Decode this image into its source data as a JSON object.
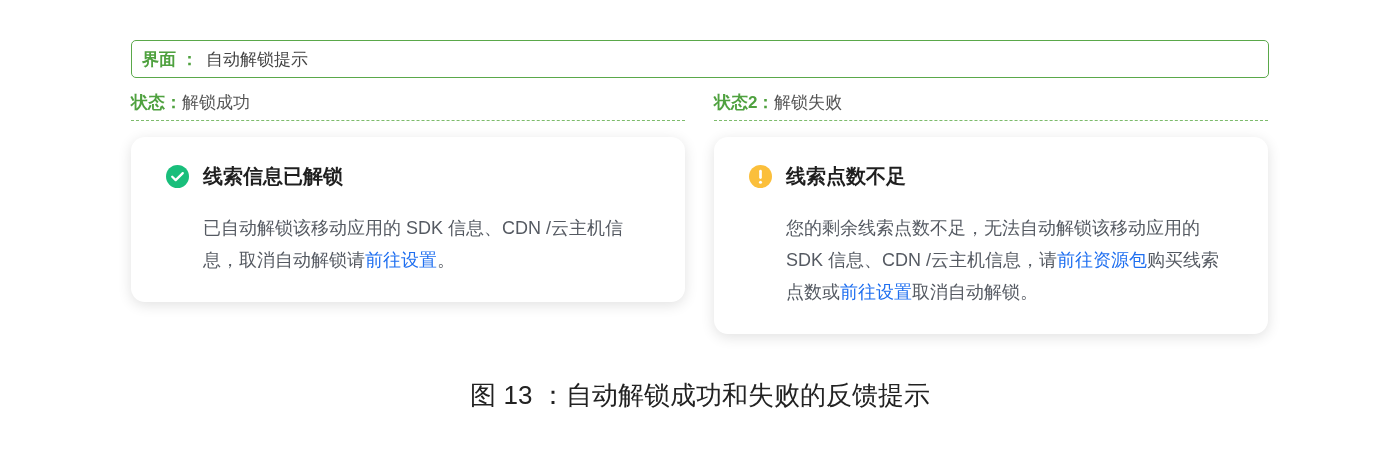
{
  "header": {
    "label": "界面 ：",
    "value": "自动解锁提示"
  },
  "states": [
    {
      "label": "状态：",
      "value": "解锁成功",
      "card": {
        "kind": "success",
        "title": "线索信息已解锁",
        "body": [
          {
            "kind": "text",
            "text": "已自动解锁该移动应用的 SDK 信息、CDN /云主机信息，取消自动解锁请"
          },
          {
            "kind": "link",
            "text": "前往设置"
          },
          {
            "kind": "text",
            "text": "。"
          }
        ]
      }
    },
    {
      "label": "状态2：",
      "value": "解锁失败",
      "card": {
        "kind": "warning",
        "title": "线索点数不足",
        "body": [
          {
            "kind": "text",
            "text": "您的剩余线索点数不足，无法自动解锁该移动应用的 SDK 信息、CDN /云主机信息，请"
          },
          {
            "kind": "link",
            "text": "前往资源包"
          },
          {
            "kind": "text",
            "text": "购买线索点数或"
          },
          {
            "kind": "link",
            "text": "前往设置"
          },
          {
            "kind": "text",
            "text": "取消自动解锁。"
          }
        ]
      }
    }
  ],
  "caption": "图 13 ：自动解锁成功和失败的反馈提示"
}
